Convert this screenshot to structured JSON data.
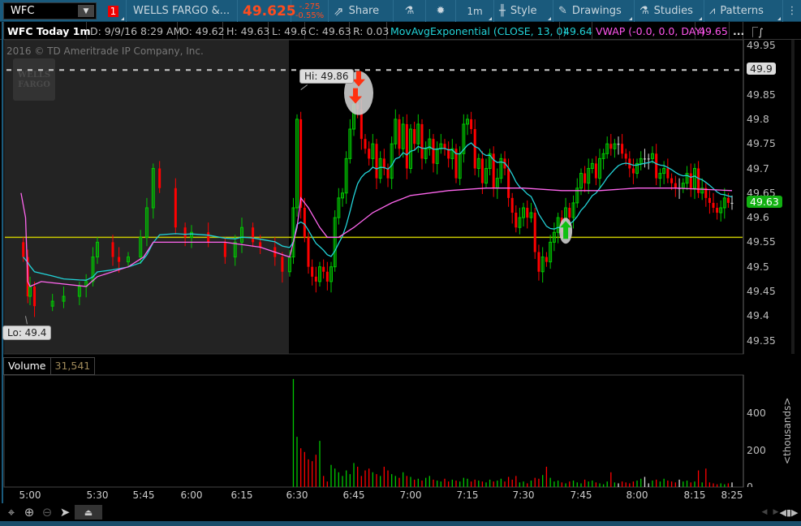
{
  "toolbar": {
    "symbol": "WFC",
    "link_badge": "1",
    "company": "WELLS FARGO &...",
    "last_price": "49.625",
    "change": "-.275",
    "change_pct": "-0.55%",
    "share": "Share",
    "timeframe": "1m",
    "style": "Style",
    "drawings": "Drawings",
    "studies": "Studies",
    "patterns": "Patterns"
  },
  "header": {
    "title": "WFC Today 1m",
    "date": "D: 9/9/16 8:29 AM",
    "open": "O: 49.62",
    "high": "H: 49.63",
    "low": "L: 49.6",
    "close": "C: 49.63",
    "range": "R: 0.03",
    "ema_label": "MovAvgExponential (CLOSE, 13, 0)",
    "ema_value": "49.64",
    "vwap_label": "VWAP (-0.0, 0.0, DAY)",
    "vwap_value": "49.65",
    "more": "..."
  },
  "watermark": {
    "copyright": "2016 © TD Ameritrade IP Company, Inc.",
    "logo": "WELLS FARGO"
  },
  "volume_pane": {
    "title": "Volume",
    "value": "31,541",
    "unit_label": "<thousands>",
    "ticks": [
      "400",
      "200",
      "0"
    ]
  },
  "colors": {
    "up": "#00c800",
    "down": "#ff0000",
    "ema": "#22d3d8",
    "vwap": "#ff66ee",
    "support": "#c8c800",
    "toolbar": "#1a5a7c",
    "price_accent": "#ff4c1e"
  },
  "chart_data": {
    "type": "candlestick",
    "title": "WFC Today 1m",
    "ylim": [
      49.33,
      49.97
    ],
    "price_ticks": [
      "49.95",
      "49.9",
      "49.85",
      "49.8",
      "49.75",
      "49.7",
      "49.65",
      "49.6",
      "49.55",
      "49.5",
      "49.45",
      "49.4",
      "49.35"
    ],
    "time_ticks": [
      "5:00",
      "5:30",
      "5:45",
      "6:00",
      "6:15",
      "6:30",
      "6:45",
      "7:00",
      "7:15",
      "7:30",
      "7:45",
      "8:00",
      "8:15",
      "8:25"
    ],
    "last_price_label": "49.63",
    "alert_line": {
      "price": 49.9,
      "label": "49.9"
    },
    "support_line": 49.56,
    "hi_label": {
      "time": "6:31",
      "price": 49.86,
      "text": "Hi: 49.86"
    },
    "lo_label": {
      "time": "4:58",
      "price": 49.4,
      "text": "Lo: 49.4"
    },
    "signals": [
      {
        "type": "sell",
        "time": "6:45",
        "price": 49.84
      },
      {
        "type": "buy",
        "time": "7:41",
        "price": 49.57
      }
    ],
    "premarket": {
      "times": [
        "4:57",
        "4:59",
        "5:00",
        "5:02",
        "5:10",
        "5:15",
        "5:22",
        "5:25",
        "5:28",
        "5:30",
        "5:35",
        "5:37",
        "5:40",
        "5:44",
        "5:46",
        "5:48",
        "5:50",
        "5:55",
        "5:58",
        "6:00",
        "6:05",
        "6:10",
        "6:13",
        "6:15",
        "6:18",
        "6:20",
        "6:24",
        "6:26",
        "6:28"
      ],
      "close": [
        49.52,
        49.44,
        49.46,
        49.42,
        49.43,
        49.44,
        49.46,
        49.47,
        49.52,
        49.55,
        49.52,
        49.51,
        49.52,
        49.56,
        49.62,
        49.7,
        49.66,
        49.58,
        49.56,
        49.57,
        49.55,
        49.52,
        49.55,
        49.58,
        49.55,
        49.54,
        49.52,
        49.49,
        49.52
      ]
    },
    "session": {
      "start": "6:29",
      "interval_min": 1,
      "close": [
        49.62,
        49.8,
        49.62,
        49.56,
        49.5,
        49.48,
        49.47,
        49.5,
        49.49,
        49.47,
        49.5,
        49.6,
        49.64,
        49.65,
        49.72,
        49.78,
        49.83,
        49.82,
        49.76,
        49.74,
        49.72,
        49.75,
        49.68,
        49.72,
        49.7,
        49.68,
        49.75,
        49.8,
        49.74,
        49.79,
        49.7,
        49.78,
        49.75,
        49.79,
        49.72,
        49.74,
        49.76,
        49.71,
        49.74,
        49.75,
        49.74,
        49.72,
        49.74,
        49.68,
        49.73,
        49.79,
        49.8,
        49.78,
        49.7,
        49.72,
        49.67,
        49.7,
        49.73,
        49.66,
        49.68,
        49.72,
        49.7,
        49.64,
        49.61,
        49.58,
        49.6,
        49.62,
        49.6,
        49.61,
        49.53,
        49.49,
        49.52,
        49.51,
        49.55,
        49.57,
        49.6,
        49.57,
        49.62,
        49.6,
        49.63,
        49.66,
        49.69,
        49.67,
        49.7,
        49.71,
        49.68,
        49.72,
        49.73,
        49.75,
        49.74,
        49.75,
        49.75,
        49.73,
        49.72,
        49.7,
        49.69,
        49.71,
        49.72,
        49.72,
        49.72,
        49.73,
        49.68,
        49.69,
        49.7,
        49.68,
        49.67,
        49.66,
        49.66,
        49.67,
        49.69,
        49.66,
        49.7,
        49.65,
        49.66,
        49.64,
        49.63,
        49.62,
        49.61,
        49.62,
        49.64,
        49.63,
        49.63
      ],
      "volume_k": [
        585,
        272,
        210,
        190,
        150,
        140,
        175,
        250,
        60,
        30,
        120,
        100,
        80,
        60,
        90,
        70,
        130,
        110,
        60,
        90,
        100,
        80,
        70,
        60,
        110,
        90,
        70,
        60,
        50,
        80,
        60,
        55,
        40,
        45,
        35,
        50,
        60,
        40,
        35,
        30,
        45,
        30,
        40,
        35,
        30,
        50,
        45,
        30,
        40,
        35,
        30,
        25,
        40,
        30,
        35,
        45,
        30,
        55,
        40,
        60,
        25,
        30,
        20,
        35,
        50,
        45,
        65,
        110,
        50,
        30,
        35,
        25,
        20,
        30,
        35,
        25,
        20,
        40,
        30,
        35,
        25,
        20,
        15,
        30,
        80,
        25,
        20,
        30,
        25,
        20,
        30,
        35,
        45,
        55,
        20,
        35,
        40,
        30,
        45,
        35,
        30,
        25,
        40,
        30,
        35,
        25,
        30,
        90,
        25,
        100,
        25,
        20,
        15,
        20,
        15,
        20,
        25,
        30
      ]
    },
    "vwap": {
      "times": [
        "4:56",
        "4:58",
        "4:59",
        "5:00",
        "5:05",
        "5:25",
        "5:30",
        "5:40",
        "5:45",
        "5:48",
        "6:10",
        "6:20",
        "6:28",
        "6:30",
        "6:31",
        "6:33",
        "6:36",
        "6:38",
        "6:41",
        "6:45",
        "6:50",
        "6:55",
        "7:00",
        "7:10",
        "7:20",
        "7:30",
        "7:40",
        "7:50",
        "8:00",
        "8:10",
        "8:25"
      ],
      "values": [
        49.65,
        49.6,
        49.47,
        49.46,
        49.47,
        49.46,
        49.48,
        49.5,
        49.52,
        49.55,
        49.55,
        49.54,
        49.52,
        49.58,
        49.64,
        49.62,
        49.58,
        49.56,
        49.56,
        49.58,
        49.61,
        49.63,
        49.645,
        49.655,
        49.66,
        49.66,
        49.655,
        49.655,
        49.66,
        49.66,
        49.655
      ]
    },
    "ema_period": 13
  }
}
